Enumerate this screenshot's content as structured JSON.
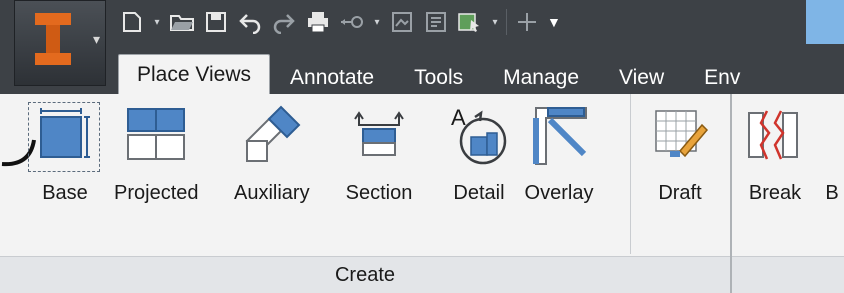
{
  "quick_access": {
    "items": [
      "new-icon",
      "open-icon",
      "save-icon",
      "undo-icon",
      "redo-icon",
      "print-icon",
      "measure-icon",
      "document-icon",
      "import-icon",
      "select-icon",
      "add-icon",
      "menu-icon"
    ]
  },
  "tabs": [
    {
      "label": "Place Views",
      "active": true
    },
    {
      "label": "Annotate",
      "active": false
    },
    {
      "label": "Tools",
      "active": false
    },
    {
      "label": "Manage",
      "active": false
    },
    {
      "label": "View",
      "active": false
    },
    {
      "label": "Env",
      "active": false
    }
  ],
  "ribbon": {
    "tools": [
      {
        "label": "Base"
      },
      {
        "label": "Projected"
      },
      {
        "label": "Auxiliary"
      },
      {
        "label": "Section"
      },
      {
        "label": "Detail"
      },
      {
        "label": "Overlay"
      },
      {
        "label": "Draft"
      },
      {
        "label": "Break"
      },
      {
        "label": "B"
      }
    ],
    "panel_title": "Create"
  },
  "colors": {
    "accent_blue": "#4f86c6",
    "dark_bar": "#3d4146",
    "ribbon_bg": "#f3f3f3",
    "logo_orange": "#e36a1e"
  }
}
